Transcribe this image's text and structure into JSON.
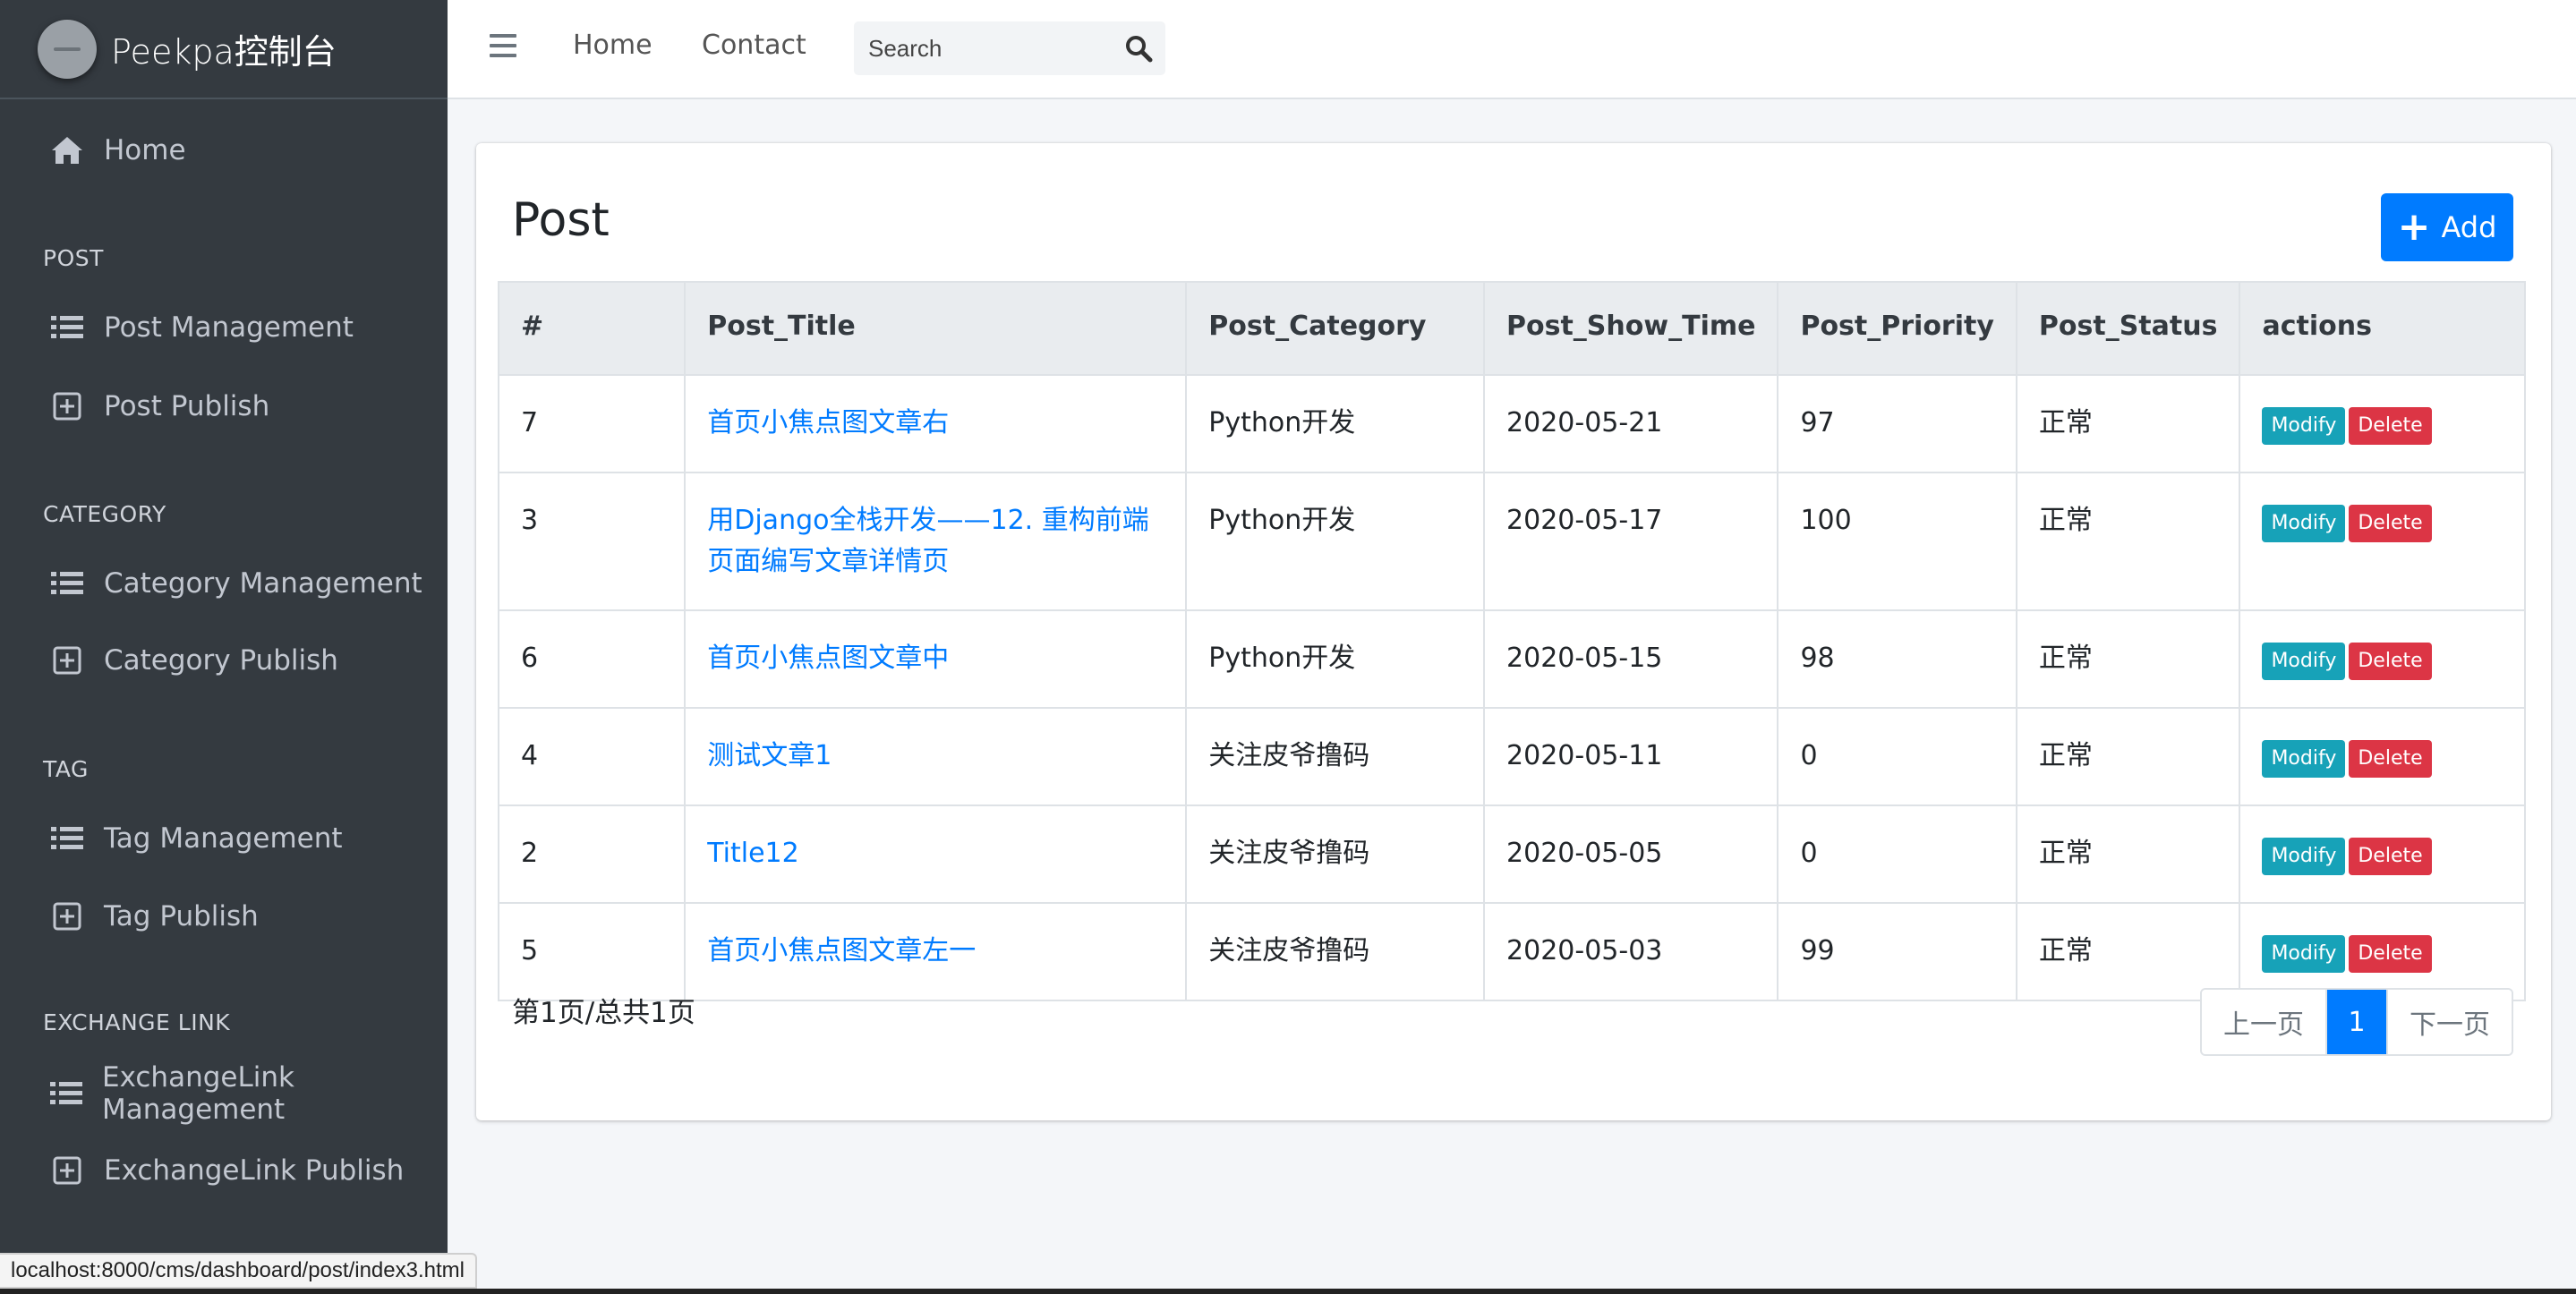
{
  "brand": {
    "title": "Peekpa控制台"
  },
  "sidebar": {
    "home": "Home",
    "sections": [
      {
        "header": "POST",
        "items": [
          {
            "label": "Post Management",
            "icon": "list-icon"
          },
          {
            "label": "Post Publish",
            "icon": "plus-square-icon"
          }
        ]
      },
      {
        "header": "CATEGORY",
        "items": [
          {
            "label": "Category Management",
            "icon": "list-icon"
          },
          {
            "label": "Category Publish",
            "icon": "plus-square-icon"
          }
        ]
      },
      {
        "header": "TAG",
        "items": [
          {
            "label": "Tag Management",
            "icon": "list-icon"
          },
          {
            "label": "Tag Publish",
            "icon": "plus-square-icon"
          }
        ]
      },
      {
        "header": "EXCHANGE LINK",
        "items": [
          {
            "label": "ExchangeLink Management",
            "icon": "list-icon"
          },
          {
            "label": "ExchangeLink Publish",
            "icon": "plus-square-icon"
          }
        ]
      }
    ]
  },
  "topbar": {
    "links": [
      "Home",
      "Contact"
    ],
    "search": {
      "placeholder": "Search",
      "value": ""
    }
  },
  "card": {
    "title": "Post",
    "add_label": "Add",
    "columns": [
      "#",
      "Post_Title",
      "Post_Category",
      "Post_Show_Time",
      "Post_Priority",
      "Post_Status",
      "actions"
    ],
    "rows": [
      {
        "id": "7",
        "title": "首页小焦点图文章右",
        "category": "Python开发",
        "show_time": "2020-05-21",
        "priority": "97",
        "status": "正常"
      },
      {
        "id": "3",
        "title": "用Django全栈开发——12. 重构前端页面编写文章详情页",
        "category": "Python开发",
        "show_time": "2020-05-17",
        "priority": "100",
        "status": "正常"
      },
      {
        "id": "6",
        "title": "首页小焦点图文章中",
        "category": "Python开发",
        "show_time": "2020-05-15",
        "priority": "98",
        "status": "正常"
      },
      {
        "id": "4",
        "title": "测试文章1",
        "category": "关注皮爷撸码",
        "show_time": "2020-05-11",
        "priority": "0",
        "status": "正常"
      },
      {
        "id": "2",
        "title": "Title12",
        "category": "关注皮爷撸码",
        "show_time": "2020-05-05",
        "priority": "0",
        "status": "正常"
      },
      {
        "id": "5",
        "title": "首页小焦点图文章左一",
        "category": "关注皮爷撸码",
        "show_time": "2020-05-03",
        "priority": "99",
        "status": "正常"
      }
    ],
    "modify_label": "Modify",
    "delete_label": "Delete",
    "page_info": "第1页/总共1页",
    "pagination": {
      "prev": "上一页",
      "current": "1",
      "next": "下一页"
    }
  },
  "status_bar": {
    "url": "localhost:8000/cms/dashboard/post/index3.html"
  },
  "colors": {
    "primary": "#007bff",
    "info": "#17a2b8",
    "danger": "#dc3545",
    "sidebar": "#343a40"
  }
}
